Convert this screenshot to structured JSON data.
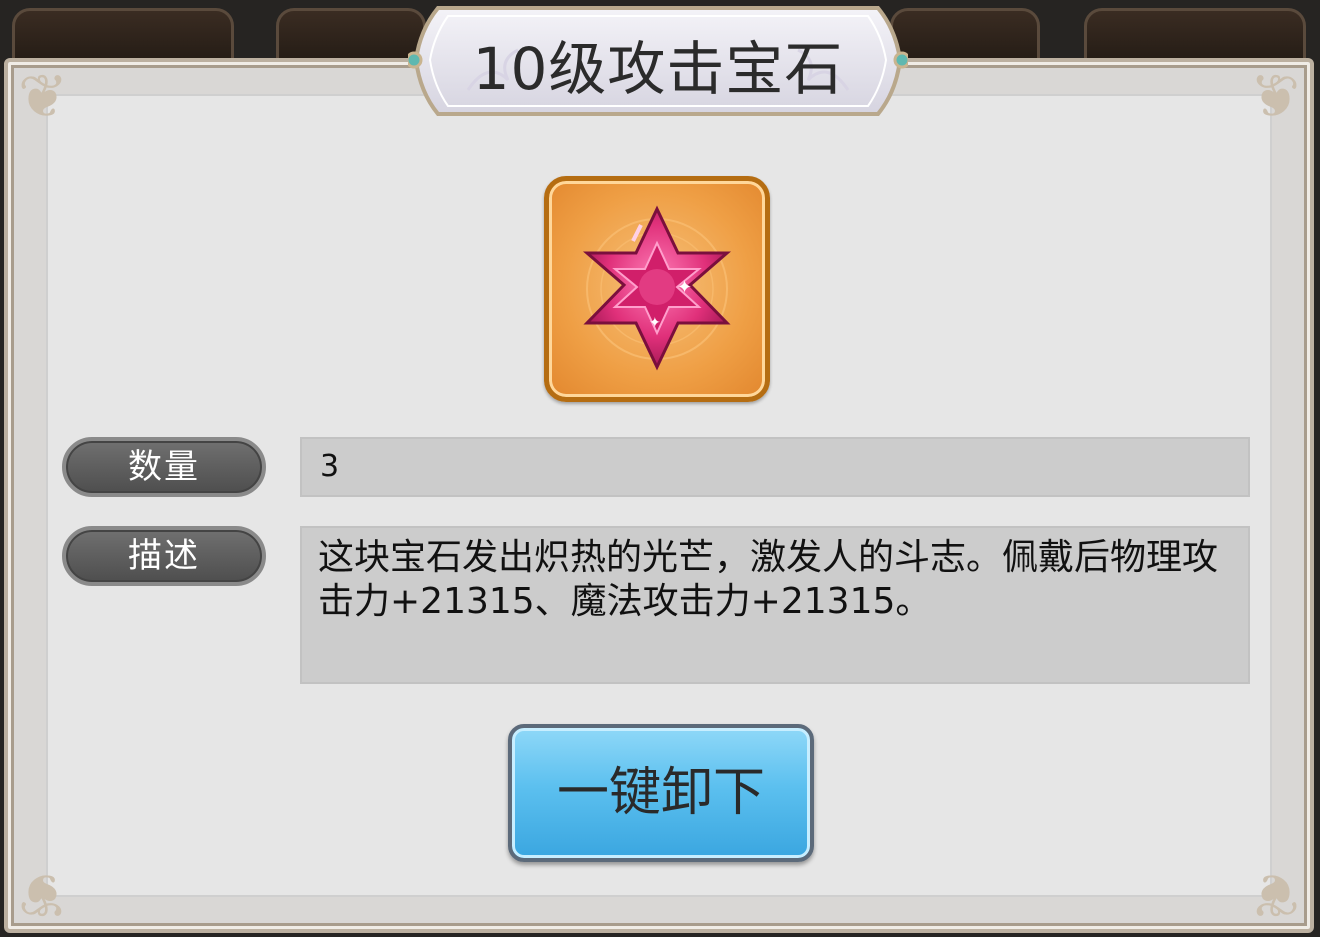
{
  "dialog": {
    "title": "10级攻击宝石",
    "item_icon": "star-gem-icon",
    "quantity_label": "数量",
    "quantity_value": "3",
    "description_label": "描述",
    "description_text": "这块宝石发出炽热的光芒，激发人的斗志。佩戴后物理攻击力+21315、魔法攻击力+21315。",
    "unequip_button": "一键卸下"
  },
  "colors": {
    "panel_bg": "#e6e6e6",
    "gem_frame": "#ef9f45",
    "gem": "#e0307a",
    "button": "#5cc0ef"
  }
}
